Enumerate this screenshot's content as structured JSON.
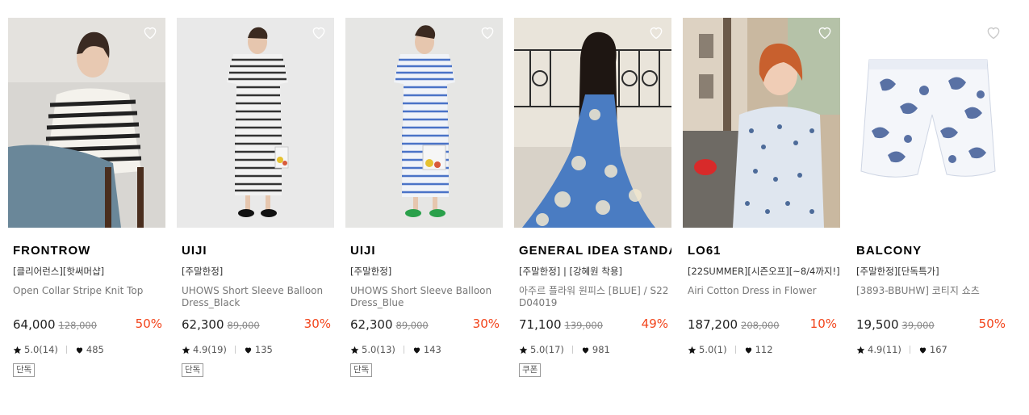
{
  "products": [
    {
      "brand": "FRONTROW",
      "tags": "[클리어런스][핫써머샵]",
      "name": "Open Collar Stripe Knit Top",
      "price": "64,000",
      "original": "128,000",
      "discount": "50%",
      "rating": "5.0(14)",
      "likes": "485",
      "badge": "단독"
    },
    {
      "brand": "UIJI",
      "tags": "[주말한정]",
      "name": "UHOWS Short Sleeve Balloon Dress_Black",
      "price": "62,300",
      "original": "89,000",
      "discount": "30%",
      "rating": "4.9(19)",
      "likes": "135",
      "badge": "단독"
    },
    {
      "brand": "UIJI",
      "tags": "[주말한정]",
      "name": "UHOWS Short Sleeve Balloon Dress_Blue",
      "price": "62,300",
      "original": "89,000",
      "discount": "30%",
      "rating": "5.0(13)",
      "likes": "143",
      "badge": "단독"
    },
    {
      "brand": "GENERAL IDEA STANDARD",
      "tags": "[주말한정] | [강혜원 착용]",
      "name": "아주르 플라워 원피스 [BLUE] / S22D04019",
      "price": "71,100",
      "original": "139,000",
      "discount": "49%",
      "rating": "5.0(17)",
      "likes": "981",
      "badge": "쿠폰"
    },
    {
      "brand": "LO61",
      "tags": "[22SUMMER][시즌오프][~8/4까지!]",
      "name": "Airi Cotton Dress in Flower",
      "price": "187,200",
      "original": "208,000",
      "discount": "10%",
      "rating": "5.0(1)",
      "likes": "112",
      "badge": ""
    },
    {
      "brand": "BALCONY",
      "tags": "[주말한정][단독특가]",
      "name": "[3893-BBUHW] 코티지 쇼츠",
      "price": "19,500",
      "original": "39,000",
      "discount": "50%",
      "rating": "4.9(11)",
      "likes": "167",
      "badge": ""
    }
  ],
  "icons": {
    "wishlist": "heart-outline-icon",
    "rating": "star-icon",
    "likes": "heart-filled-icon"
  },
  "colors": {
    "discount": "#f2441b",
    "text": "#222222",
    "muted": "#888888"
  }
}
